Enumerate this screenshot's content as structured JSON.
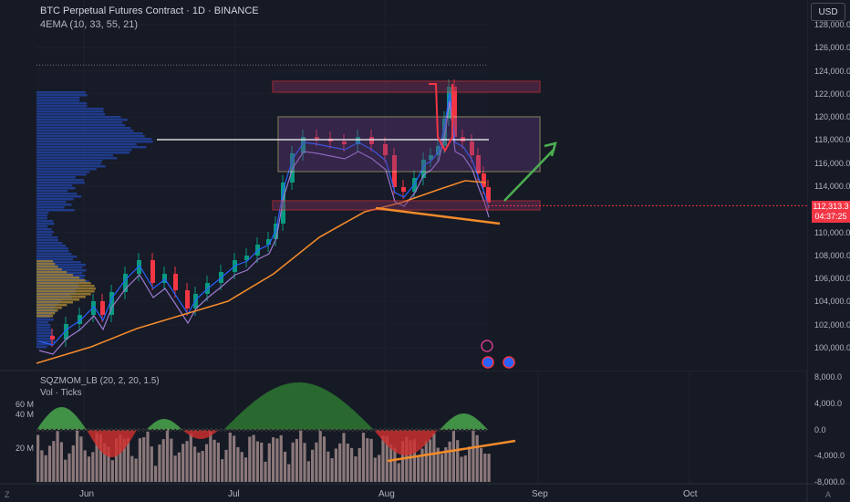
{
  "header": {
    "title": "BTC Perpetual Futures Contract · 1D · BINANCE",
    "indicator": "4EMA (10, 33, 55, 21)",
    "currency_button": "USD"
  },
  "price_label": {
    "price": "112,313.3",
    "countdown": "04:37:25",
    "color": "#f23645"
  },
  "price_axis": [
    "128,000.0",
    "126,000.0",
    "124,000.0",
    "122,000.0",
    "120,000.0",
    "118,000.0",
    "116,000.0",
    "114,000.0",
    "112,000.0",
    "110,000.0",
    "108,000.0",
    "106,000.0",
    "104,000.0",
    "102,000.0",
    "100,000.0"
  ],
  "lower_pane": {
    "squeeze_label": "SQZMOM_LB (20, 2, 20, 1.5)",
    "volume_label": "Vol · Ticks",
    "right_axis": [
      "8,000.0",
      "4,000.0",
      "0.0",
      "-4,000.0",
      "-8,000.0"
    ],
    "left_axis": [
      "60 M",
      "40 M",
      "20 M"
    ]
  },
  "time_axis": [
    "Jun",
    "Jul",
    "Aug",
    "Sep",
    "Oct"
  ],
  "corner_labels": {
    "left": "Z",
    "right": "A"
  },
  "colors": {
    "background": "#161a25",
    "up": "#089981",
    "down": "#f23645",
    "ema_fast": "#2962ff",
    "ema_mid": "#9c7bd1",
    "ema_slow": "#f28b2b",
    "range_box": "#f7e79a",
    "zone_box": "#f23645",
    "volume_profile": "#2962ff",
    "volume_profile_value": "#e8b63a",
    "arrow": "#4caf50",
    "trendline": "#f28b2b"
  }
}
